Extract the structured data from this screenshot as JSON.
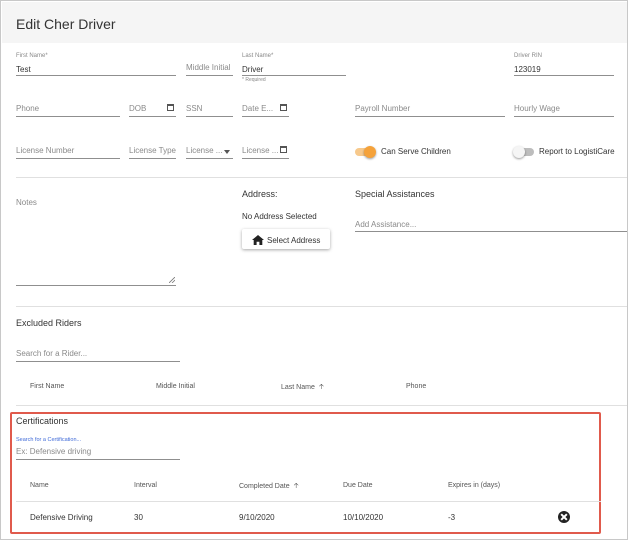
{
  "header": {
    "title": "Edit Cher Driver"
  },
  "row1": {
    "first_name": {
      "label": "First Name*",
      "value": "Test"
    },
    "middle_initial": {
      "placeholder": "Middle Initial"
    },
    "last_name": {
      "label": "Last Name*",
      "value": "Driver",
      "hint": "* Required"
    },
    "driver_rin": {
      "label": "Driver RIN",
      "value": "123019"
    }
  },
  "row2": {
    "phone": "Phone",
    "dob": "DOB",
    "ssn": "SSN",
    "date_e": "Date E...",
    "payroll": "Payroll Number",
    "hourly": "Hourly Wage"
  },
  "row3": {
    "license_number": "License Number",
    "license_type": "License Type",
    "license_select": "License ...",
    "license_date": "License ...",
    "can_serve_children": {
      "label": "Can Serve Children",
      "on": true
    },
    "report_logisticare": {
      "label": "Report to LogistiCare",
      "on": false
    }
  },
  "notes": {
    "placeholder": "Notes"
  },
  "address": {
    "label": "Address:",
    "status": "No Address Selected",
    "button": "Select Address"
  },
  "special": {
    "label": "Special Assistances",
    "placeholder": "Add Assistance..."
  },
  "excluded": {
    "title": "Excluded Riders",
    "search_placeholder": "Search for a Rider...",
    "columns": [
      "First Name",
      "Middle Initial",
      "Last Name",
      "Phone"
    ]
  },
  "certifications": {
    "title": "Certifications",
    "search_label": "Search for a Certification...",
    "search_placeholder": "Ex: Defensive driving",
    "columns": [
      "Name",
      "Interval",
      "Completed Date",
      "Due Date",
      "Expires in (days)"
    ],
    "rows": [
      {
        "name": "Defensive Driving",
        "interval": "30",
        "completed": "9/10/2020",
        "due": "10/10/2020",
        "expires": "-3"
      }
    ]
  },
  "colors": {
    "accent": "#f5a23a",
    "highlight": "#e05a4c",
    "link": "#3f6ad8"
  }
}
